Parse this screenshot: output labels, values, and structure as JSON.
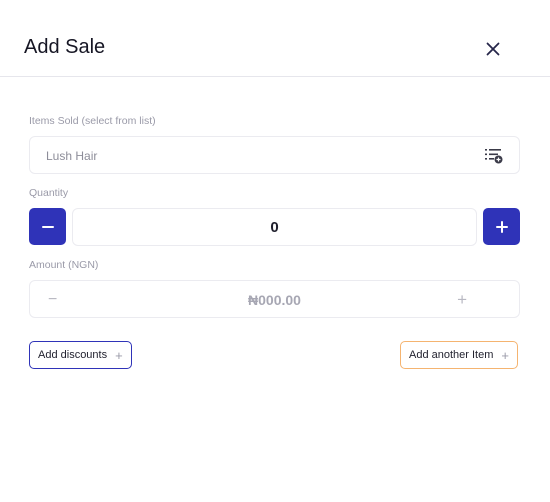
{
  "dialog": {
    "title": "Add Sale"
  },
  "items_sold": {
    "label": "Items Sold (select from list)",
    "value": "Lush Hair"
  },
  "quantity": {
    "label": "Quantity",
    "value": "0",
    "decrement_symbol": "−",
    "increment_symbol": "+"
  },
  "amount": {
    "label": "Amount  (NGN)",
    "value": "₦000.00",
    "decrement_symbol": "−",
    "increment_symbol": "+"
  },
  "actions": {
    "add_discounts": "Add discounts",
    "add_another_item": "Add another Item",
    "plus_symbol": "+"
  },
  "colors": {
    "primary": "#2f33b8",
    "discount_border": "#2f33b8",
    "another_item_border": "#f5b470"
  },
  "icons": {
    "close": "close-icon",
    "list": "list-add-icon",
    "minus": "minus-icon",
    "plus": "plus-icon"
  }
}
